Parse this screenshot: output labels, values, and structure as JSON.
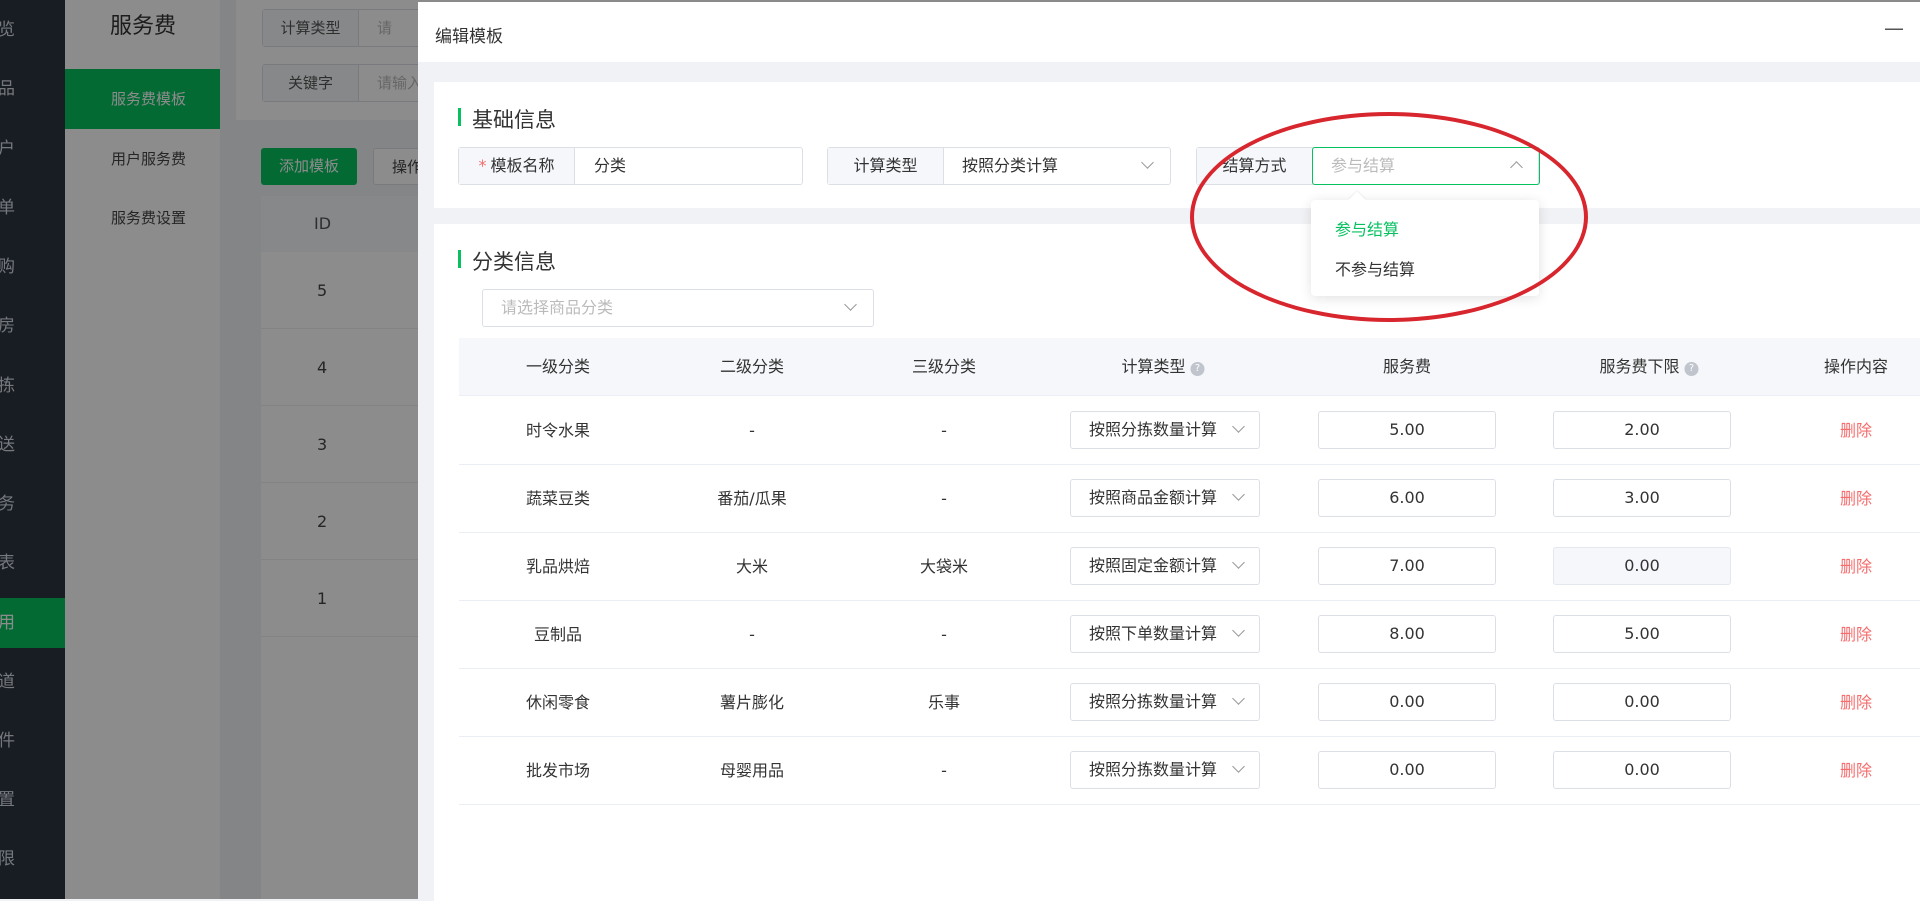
{
  "sidebar": {
    "items": [
      {
        "label": "览"
      },
      {
        "label": "品"
      },
      {
        "label": "户"
      },
      {
        "label": "单"
      },
      {
        "label": "购"
      },
      {
        "label": "房"
      },
      {
        "label": "拣"
      },
      {
        "label": "送"
      },
      {
        "label": "务"
      },
      {
        "label": "表"
      },
      {
        "label": "用",
        "active": true
      },
      {
        "label": "道"
      },
      {
        "label": "件"
      },
      {
        "label": "置"
      },
      {
        "label": "限"
      }
    ]
  },
  "subnav": {
    "title": "服务费",
    "items": [
      {
        "label": "服务费模板",
        "active": true
      },
      {
        "label": "用户服务费"
      },
      {
        "label": "服务费设置"
      }
    ]
  },
  "background": {
    "filter_calc_type_label": "计算类型",
    "filter_calc_type_placeholder": "请",
    "filter_keyword_label": "关键字",
    "filter_keyword_placeholder": "请输入",
    "add_button": "添加模板",
    "op_button": "操作",
    "table_header_id": "ID",
    "ids": [
      "5",
      "4",
      "3",
      "2",
      "1"
    ]
  },
  "modal": {
    "title": "编辑模板",
    "minimize": "—",
    "basic": {
      "section_title": "基础信息",
      "name_label": "模板名称",
      "required_mark": "*",
      "name_value": "分类",
      "calc_type_label": "计算类型",
      "calc_type_value": "按照分类计算",
      "settle_label": "结算方式",
      "settle_placeholder": "参与结算",
      "settle_options": [
        "参与结算",
        "不参与结算"
      ]
    },
    "category": {
      "section_title": "分类信息",
      "select_placeholder": "请选择商品分类",
      "columns": [
        "一级分类",
        "二级分类",
        "三级分类",
        "计算类型",
        "服务费",
        "服务费下限",
        "操作内容"
      ],
      "help_mark": "?",
      "rows": [
        {
          "l1": "时令水果",
          "l2": "-",
          "l3": "-",
          "calc": "按照分拣数量计算",
          "fee": "5.00",
          "min": "2.00",
          "min_disabled": false,
          "action": "删除"
        },
        {
          "l1": "蔬菜豆类",
          "l2": "番茄/瓜果",
          "l3": "-",
          "calc": "按照商品金额计算",
          "fee": "6.00",
          "min": "3.00",
          "min_disabled": false,
          "action": "删除"
        },
        {
          "l1": "乳品烘焙",
          "l2": "大米",
          "l3": "大袋米",
          "calc": "按照固定金额计算",
          "fee": "7.00",
          "min": "0.00",
          "min_disabled": true,
          "action": "删除"
        },
        {
          "l1": "豆制品",
          "l2": "-",
          "l3": "-",
          "calc": "按照下单数量计算",
          "fee": "8.00",
          "min": "5.00",
          "min_disabled": false,
          "action": "删除"
        },
        {
          "l1": "休闲零食",
          "l2": "薯片膨化",
          "l3": "乐事",
          "calc": "按照分拣数量计算",
          "fee": "0.00",
          "min": "0.00",
          "min_disabled": false,
          "action": "删除"
        },
        {
          "l1": "批发市场",
          "l2": "母婴用品",
          "l3": "-",
          "calc": "按照分拣数量计算",
          "fee": "0.00",
          "min": "0.00",
          "min_disabled": false,
          "action": "删除"
        }
      ]
    }
  },
  "colors": {
    "accent": "#07c160",
    "danger": "#f56c6c",
    "sidebar_bg": "#2c3440",
    "annotation": "#d8262e"
  }
}
